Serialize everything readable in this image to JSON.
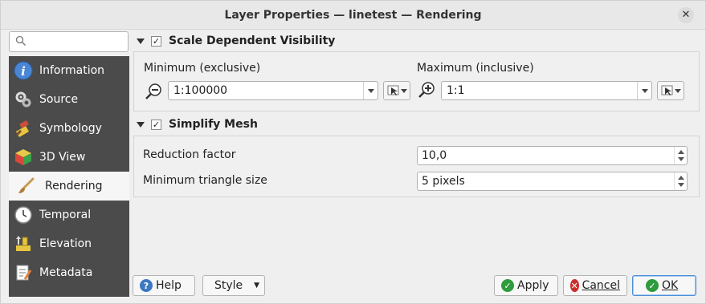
{
  "window": {
    "title": "Layer Properties — linetest — Rendering"
  },
  "sidebar": {
    "search_placeholder": "",
    "items": [
      {
        "label": "Information",
        "icon": "info-icon"
      },
      {
        "label": "Source",
        "icon": "source-icon"
      },
      {
        "label": "Symbology",
        "icon": "symbology-icon"
      },
      {
        "label": "3D View",
        "icon": "cube-3d-icon"
      },
      {
        "label": "Rendering",
        "icon": "paintbrush-icon",
        "active": true
      },
      {
        "label": "Temporal",
        "icon": "clock-icon"
      },
      {
        "label": "Elevation",
        "icon": "elevation-icon"
      },
      {
        "label": "Metadata",
        "icon": "metadata-icon"
      }
    ]
  },
  "scale_visibility": {
    "title": "Scale Dependent Visibility",
    "checked": true,
    "min_label": "Minimum (exclusive)",
    "min_value": "1:100000",
    "max_label": "Maximum (inclusive)",
    "max_value": "1:1"
  },
  "simplify_mesh": {
    "title": "Simplify Mesh",
    "checked": true,
    "reduction_label": "Reduction factor",
    "reduction_value": "10,0",
    "min_triangle_label": "Minimum triangle size",
    "min_triangle_value": "5 pixels"
  },
  "buttons": {
    "help": "Help",
    "style": "Style",
    "apply": "Apply",
    "cancel": "Cancel",
    "ok": "OK"
  },
  "colors": {
    "sidebar_bg": "#4b4b4b",
    "apply_green": "#2e9b3c",
    "cancel_red": "#c9302c",
    "help_blue": "#3b78c3"
  }
}
